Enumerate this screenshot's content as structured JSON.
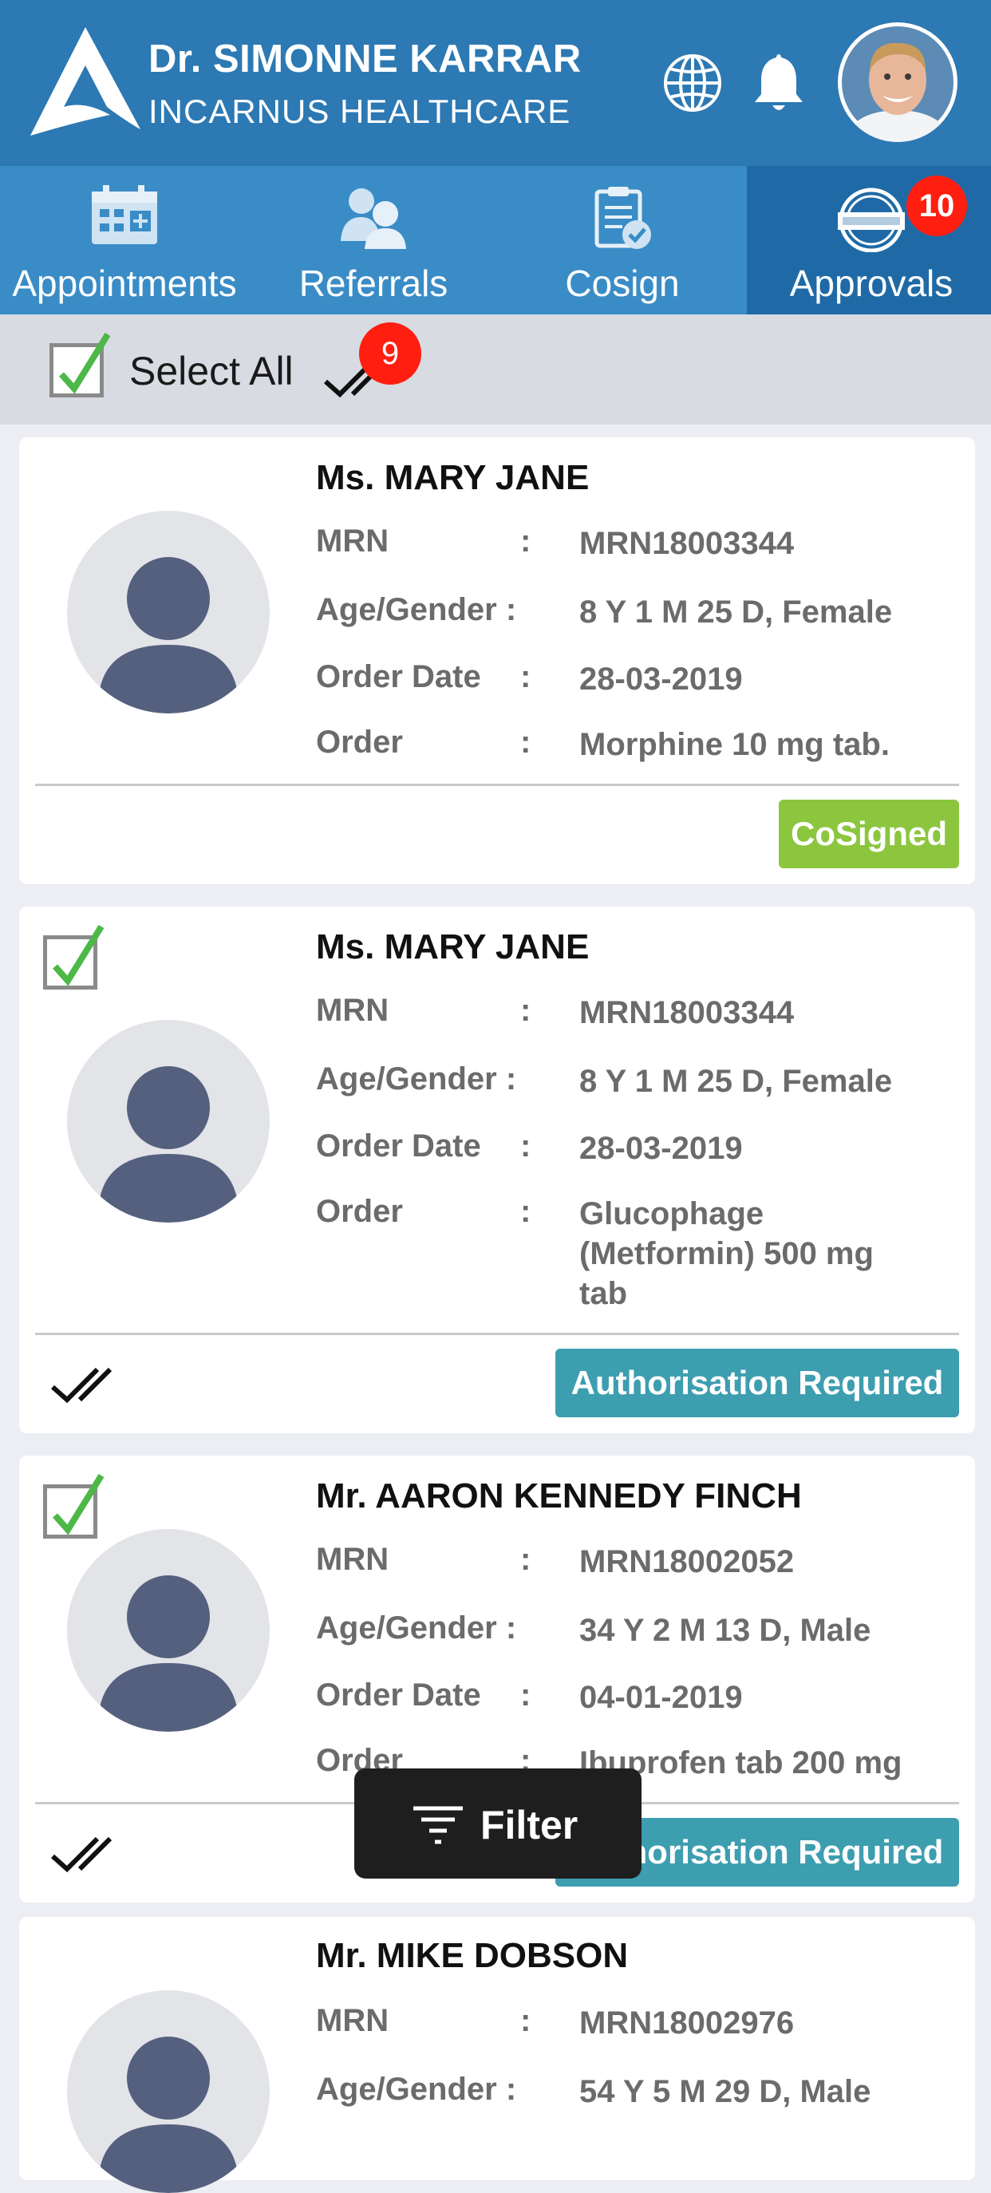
{
  "header": {
    "doctor_name": "Dr. SIMONNE KARRAR",
    "organization": "INCARNUS HEALTHCARE",
    "colors": {
      "header_bg": "#2c79b3",
      "tabs_bg": "#3a8cc6",
      "active_tab_bg": "#1f6aa6"
    }
  },
  "tabs": [
    {
      "label": "Appointments",
      "icon": "calendar-icon"
    },
    {
      "label": "Referrals",
      "icon": "referrals-icon"
    },
    {
      "label": "Cosign",
      "icon": "clipboard-check-icon"
    },
    {
      "label": "Approvals",
      "icon": "approval-stamp-icon",
      "badge": "10",
      "active": true
    }
  ],
  "select_bar": {
    "label": "Select All",
    "checked": true,
    "count_badge": "9"
  },
  "row_labels": {
    "mrn": "MRN",
    "age_gender": "Age/Gender :",
    "order_date": "Order Date",
    "order": "Order",
    "colon": ":"
  },
  "cards": [
    {
      "name": "Ms. MARY JANE",
      "mrn": "MRN18003344",
      "age_gender": "8 Y 1 M 25 D, Female",
      "order_date": "28-03-2019",
      "order": "Morphine 10 mg tab.",
      "status": "CoSigned",
      "status_color": "#8cc63f",
      "checked": false
    },
    {
      "name": "Ms. MARY JANE",
      "mrn": "MRN18003344",
      "age_gender": "8 Y 1 M 25 D, Female",
      "order_date": "28-03-2019",
      "order": "Glucophage (Metformin) 500 mg tab",
      "status": "Authorisation Required",
      "status_color": "#3d9eb0",
      "checked": true
    },
    {
      "name": "Mr. AARON KENNEDY FINCH",
      "mrn": "MRN18002052",
      "age_gender": "34 Y 2 M 13 D, Male",
      "order_date": "04-01-2019",
      "order": "Ibuprofen tab 200 mg",
      "status": "Authorisation Required",
      "status_color": "#3d9eb0",
      "checked": true
    },
    {
      "name": "Mr. MIKE DOBSON",
      "mrn": "MRN18002976",
      "age_gender": "54 Y 5 M 29 D, Male",
      "checked": false
    }
  ],
  "filter": {
    "label": "Filter",
    "icon": "filter-icon"
  }
}
